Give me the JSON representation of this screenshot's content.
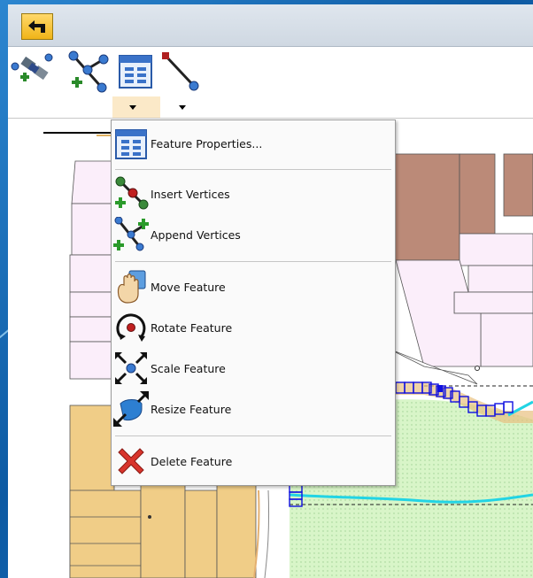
{
  "toolbar": {
    "back_button": "back-arrow-icon",
    "tools": [
      "edit-vertices-icon",
      "insert-vertex-icon",
      "feature-properties-icon",
      "vertex-tool-icon"
    ]
  },
  "menu": {
    "items": [
      {
        "label": "Feature Properties...",
        "icon": "feature-properties-icon"
      },
      {
        "label": "Insert Vertices",
        "icon": "insert-vertices-icon"
      },
      {
        "label": "Append Vertices",
        "icon": "append-vertices-icon"
      },
      {
        "label": "Move Feature",
        "icon": "move-feature-icon"
      },
      {
        "label": "Rotate Feature",
        "icon": "rotate-feature-icon"
      },
      {
        "label": "Scale Feature",
        "icon": "scale-feature-icon"
      },
      {
        "label": "Resize Feature",
        "icon": "resize-feature-icon"
      },
      {
        "label": "Delete Feature",
        "icon": "delete-feature-icon"
      }
    ]
  },
  "colors": {
    "frame": "#1a6fb8",
    "parcel_pink": "#fbeefa",
    "parcel_brown": "#bb8a78",
    "parcel_tan": "#f0cd87",
    "park_green": "#d8f5c8",
    "highlight_blue": "#1010e0",
    "water_cyan": "#22d4e4"
  }
}
